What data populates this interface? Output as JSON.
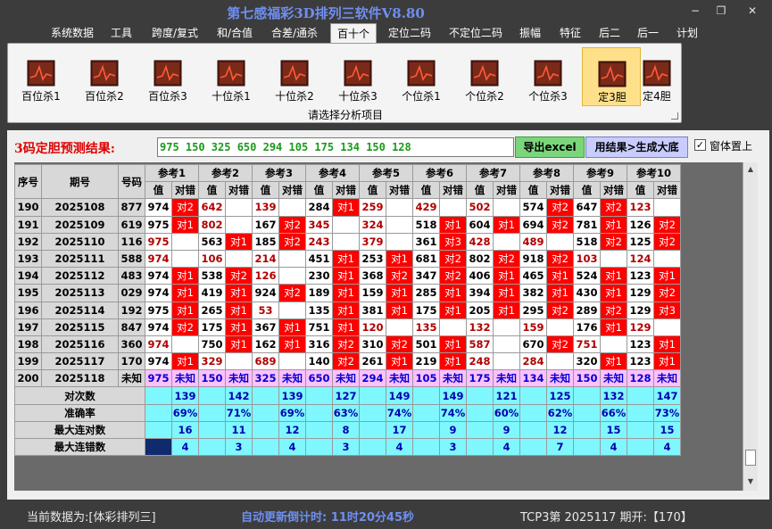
{
  "window": {
    "title": "第七感福彩3D排列三软件V8.80",
    "min": "−",
    "restore": "❐",
    "close": "✕"
  },
  "menu": [
    "系统数据",
    "工具",
    "跨度/复式",
    "和/合值",
    "合差/通杀",
    "百十个",
    "定位二码",
    "不定位二码",
    "振幅",
    "特征",
    "后二",
    "后一",
    "计划"
  ],
  "menu_active": 5,
  "ribbon": {
    "buttons": [
      "百位杀1",
      "百位杀2",
      "百位杀3",
      "十位杀1",
      "十位杀2",
      "十位杀3",
      "个位杀1",
      "个位杀2",
      "个位杀3",
      "定3胆",
      "定4胆"
    ],
    "selected": 9,
    "caption": "请选择分析项目"
  },
  "panel": {
    "result_label": "3码定胆预测结果:",
    "result_value": "975 150 325 650 294 105 175 134 150 128",
    "excel_button": "导出excel",
    "generate_button": "用结果>生成大底",
    "always_on_top_label": "窗体置上",
    "always_on_top_checked": "✓"
  },
  "grid": {
    "head_fixed": [
      "序号",
      "期号",
      "号码"
    ],
    "ref_groups": [
      "参考1",
      "参考2",
      "参考3",
      "参考4",
      "参考5",
      "参考6",
      "参考7",
      "参考8",
      "参考9",
      "参考10"
    ],
    "sub_val": "值",
    "sub_hit": "对错",
    "rows": [
      {
        "seq": "190",
        "issue": "2025108",
        "num": "877",
        "cells": [
          [
            "974",
            "对2"
          ],
          [
            "642",
            ""
          ],
          [
            "139",
            ""
          ],
          [
            "284",
            "对1"
          ],
          [
            "259",
            ""
          ],
          [
            "429",
            ""
          ],
          [
            "502",
            ""
          ],
          [
            "574",
            "对2"
          ],
          [
            "647",
            "对2"
          ],
          [
            "123",
            ""
          ]
        ]
      },
      {
        "seq": "191",
        "issue": "2025109",
        "num": "619",
        "cells": [
          [
            "975",
            "对1"
          ],
          [
            "802",
            ""
          ],
          [
            "167",
            "对2"
          ],
          [
            "345",
            ""
          ],
          [
            "324",
            ""
          ],
          [
            "518",
            "对1"
          ],
          [
            "604",
            "对1"
          ],
          [
            "694",
            "对2"
          ],
          [
            "781",
            "对1"
          ],
          [
            "126",
            "对2"
          ]
        ]
      },
      {
        "seq": "192",
        "issue": "2025110",
        "num": "116",
        "cells": [
          [
            "975",
            ""
          ],
          [
            "563",
            "对1"
          ],
          [
            "185",
            "对2"
          ],
          [
            "243",
            ""
          ],
          [
            "379",
            ""
          ],
          [
            "361",
            "对3"
          ],
          [
            "428",
            ""
          ],
          [
            "489",
            ""
          ],
          [
            "518",
            "对2"
          ],
          [
            "125",
            "对2"
          ]
        ]
      },
      {
        "seq": "193",
        "issue": "2025111",
        "num": "588",
        "cells": [
          [
            "974",
            ""
          ],
          [
            "106",
            ""
          ],
          [
            "214",
            ""
          ],
          [
            "451",
            "对1"
          ],
          [
            "253",
            "对1"
          ],
          [
            "681",
            "对2"
          ],
          [
            "802",
            "对2"
          ],
          [
            "918",
            "对2"
          ],
          [
            "103",
            ""
          ],
          [
            "124",
            ""
          ]
        ]
      },
      {
        "seq": "194",
        "issue": "2025112",
        "num": "483",
        "cells": [
          [
            "974",
            "对1"
          ],
          [
            "538",
            "对2"
          ],
          [
            "126",
            ""
          ],
          [
            "230",
            "对1"
          ],
          [
            "368",
            "对2"
          ],
          [
            "347",
            "对2"
          ],
          [
            "406",
            "对1"
          ],
          [
            "465",
            "对1"
          ],
          [
            "524",
            "对1"
          ],
          [
            "123",
            "对1"
          ]
        ]
      },
      {
        "seq": "195",
        "issue": "2025113",
        "num": "029",
        "cells": [
          [
            "974",
            "对1"
          ],
          [
            "419",
            "对1"
          ],
          [
            "924",
            "对2"
          ],
          [
            "189",
            "对1"
          ],
          [
            "159",
            "对1"
          ],
          [
            "285",
            "对1"
          ],
          [
            "394",
            "对1"
          ],
          [
            "382",
            "对1"
          ],
          [
            "430",
            "对1"
          ],
          [
            "129",
            "对2"
          ]
        ]
      },
      {
        "seq": "196",
        "issue": "2025114",
        "num": "192",
        "cells": [
          [
            "975",
            "对1"
          ],
          [
            "265",
            "对1"
          ],
          [
            "53",
            ""
          ],
          [
            "135",
            "对1"
          ],
          [
            "381",
            "对1"
          ],
          [
            "175",
            "对1"
          ],
          [
            "205",
            "对1"
          ],
          [
            "295",
            "对2"
          ],
          [
            "289",
            "对2"
          ],
          [
            "129",
            "对3"
          ]
        ]
      },
      {
        "seq": "197",
        "issue": "2025115",
        "num": "847",
        "cells": [
          [
            "974",
            "对2"
          ],
          [
            "175",
            "对1"
          ],
          [
            "367",
            "对1"
          ],
          [
            "751",
            "对1"
          ],
          [
            "120",
            ""
          ],
          [
            "135",
            ""
          ],
          [
            "132",
            ""
          ],
          [
            "159",
            ""
          ],
          [
            "176",
            "对1"
          ],
          [
            "129",
            ""
          ]
        ]
      },
      {
        "seq": "198",
        "issue": "2025116",
        "num": "360",
        "cells": [
          [
            "974",
            ""
          ],
          [
            "750",
            "对1"
          ],
          [
            "162",
            "对1"
          ],
          [
            "316",
            "对2"
          ],
          [
            "310",
            "对2"
          ],
          [
            "501",
            "对1"
          ],
          [
            "587",
            ""
          ],
          [
            "670",
            "对2"
          ],
          [
            "751",
            ""
          ],
          [
            "123",
            "对1"
          ]
        ]
      },
      {
        "seq": "199",
        "issue": "2025117",
        "num": "170",
        "cells": [
          [
            "974",
            "对1"
          ],
          [
            "329",
            ""
          ],
          [
            "689",
            ""
          ],
          [
            "140",
            "对2"
          ],
          [
            "261",
            "对1"
          ],
          [
            "219",
            "对1"
          ],
          [
            "248",
            ""
          ],
          [
            "284",
            ""
          ],
          [
            "320",
            "对1"
          ],
          [
            "123",
            "对1"
          ]
        ]
      },
      {
        "seq": "200",
        "issue": "2025118",
        "num": "未知",
        "cells": [
          [
            "975",
            "未知"
          ],
          [
            "150",
            "未知"
          ],
          [
            "325",
            "未知"
          ],
          [
            "650",
            "未知"
          ],
          [
            "294",
            "未知"
          ],
          [
            "105",
            "未知"
          ],
          [
            "175",
            "未知"
          ],
          [
            "134",
            "未知"
          ],
          [
            "150",
            "未知"
          ],
          [
            "128",
            "未知"
          ]
        ]
      }
    ],
    "stats": [
      {
        "label": "对次数",
        "values": [
          "139",
          "142",
          "139",
          "127",
          "149",
          "149",
          "121",
          "125",
          "132",
          "147"
        ]
      },
      {
        "label": "准确率",
        "values": [
          "69%",
          "71%",
          "69%",
          "63%",
          "74%",
          "74%",
          "60%",
          "62%",
          "66%",
          "73%"
        ]
      },
      {
        "label": "最大连对数",
        "values": [
          "16",
          "11",
          "12",
          "8",
          "17",
          "9",
          "9",
          "12",
          "15",
          "15"
        ]
      },
      {
        "label": "最大连错数",
        "values": [
          "4",
          "3",
          "4",
          "3",
          "4",
          "3",
          "4",
          "7",
          "4",
          "4"
        ]
      }
    ]
  },
  "scrollbar": {
    "up": "▲",
    "down": "▼"
  },
  "status": {
    "left": "当前数据为:[体彩排列三]",
    "mid": "自动更新倒计时:  11时20分45秒",
    "right": "TCP3第 2025117 期开:【170】"
  },
  "colors": {
    "hit": "#ff0000",
    "predict_row": "#ffc0ff",
    "stats_bg": "#7ff7ff",
    "title": "#6f8ff0",
    "result_red": "#e00000",
    "result_green": "#1a9a1a"
  }
}
